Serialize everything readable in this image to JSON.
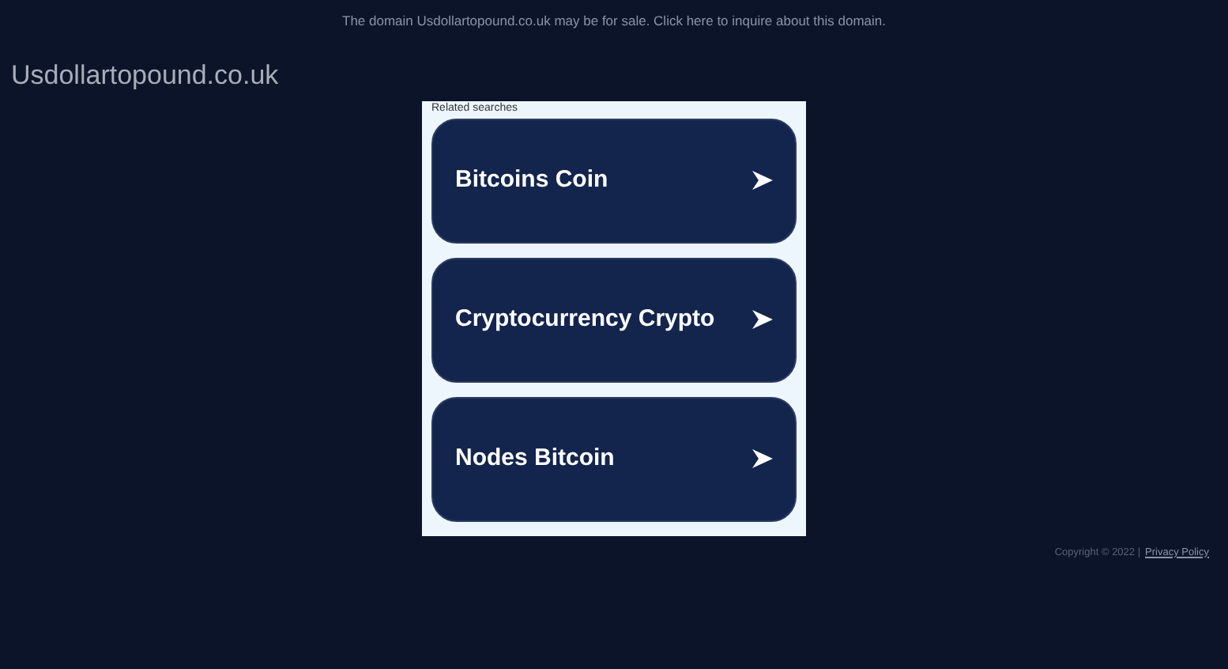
{
  "banner": "The domain Usdollartopound.co.uk may be for sale. Click here to inquire about this domain.",
  "site_title": "Usdollartopound.co.uk",
  "related": {
    "heading": "Related searches",
    "links": [
      {
        "label": "Bitcoins Coin"
      },
      {
        "label": "Cryptocurrency Crypto"
      },
      {
        "label": "Nodes Bitcoin"
      }
    ]
  },
  "footer": {
    "copyright": "Copyright © 2022 |",
    "link": "Privacy Policy"
  }
}
